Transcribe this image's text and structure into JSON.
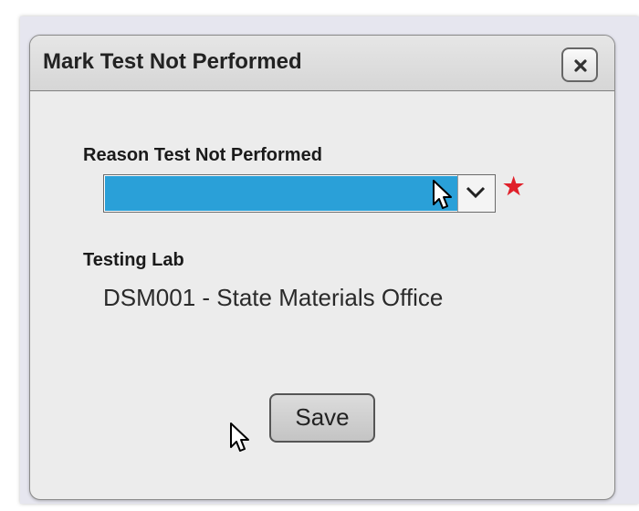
{
  "dialog": {
    "title": "Mark Test Not Performed",
    "close_icon": "close-icon"
  },
  "reason_field": {
    "label": "Reason Test Not Performed",
    "selected_value": "",
    "required_marker": "★",
    "required_color": "#e0202a",
    "highlight_color": "#2aa0d8",
    "arrow_icon": "chevron-down-icon"
  },
  "testing_lab": {
    "label": "Testing Lab",
    "value": "DSM001 - State Materials Office"
  },
  "actions": {
    "save_label": "Save"
  },
  "cursors": [
    "mouse-pointer-icon",
    "mouse-pointer-icon"
  ]
}
